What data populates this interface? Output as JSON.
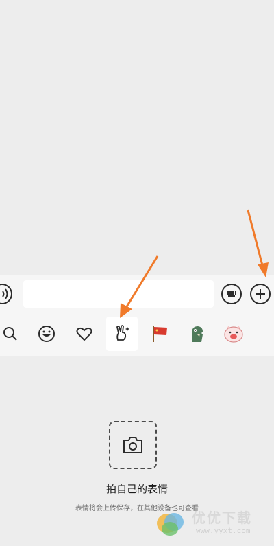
{
  "input": {
    "value": "",
    "placeholder": ""
  },
  "emoji_tabs": [
    {
      "icon": "search-icon"
    },
    {
      "icon": "smiley-icon"
    },
    {
      "icon": "heart-icon"
    },
    {
      "icon": "selfie-sticker-icon",
      "selected": true
    },
    {
      "icon": "red-flag-sticker-icon"
    },
    {
      "icon": "dinosaur-sticker-icon"
    },
    {
      "icon": "pig-sticker-icon"
    }
  ],
  "panel": {
    "title": "拍自己的表情",
    "description": "表情将会上传保存，在其他设备也可查看"
  },
  "watermark": {
    "text": "优优下载",
    "url": "www.yyxt.com"
  },
  "colors": {
    "arrow": "#f07a2a",
    "background": "#ededed",
    "bar": "#f6f6f6"
  }
}
